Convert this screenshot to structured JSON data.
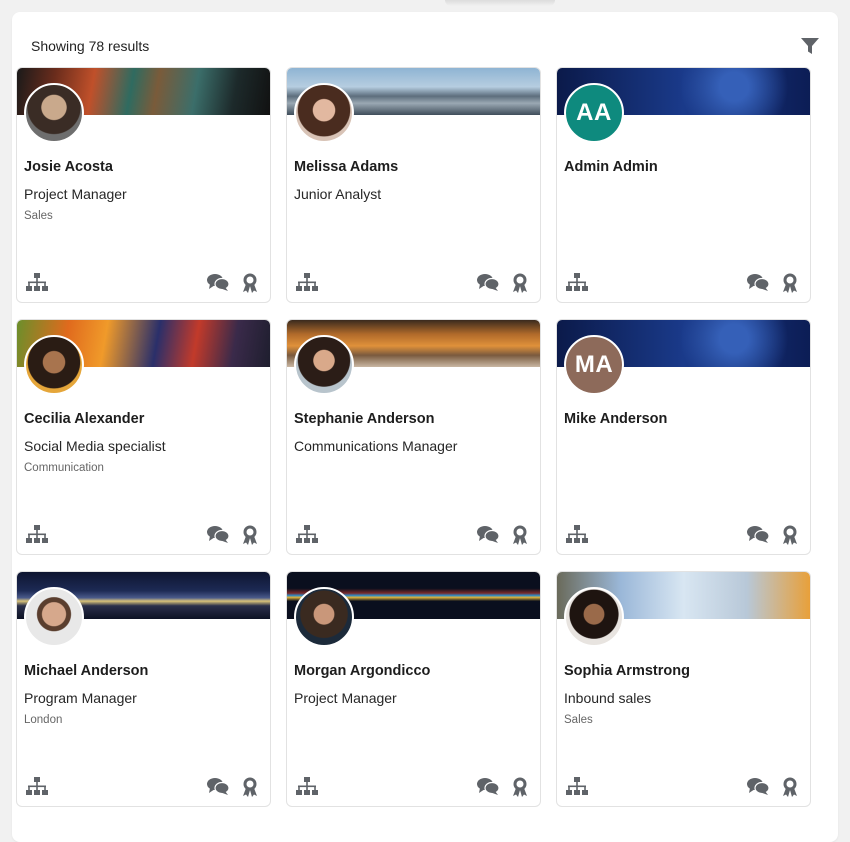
{
  "header": {
    "results_text": "Showing 78 results"
  },
  "icons": {
    "filter": "filter-icon",
    "org": "org-chart-icon",
    "chat": "chat-icon",
    "badge": "badge-icon"
  },
  "colors": {
    "icon_gray": "#5f6368",
    "admin_avatar": "#0e8a7e",
    "mike_avatar": "#8d6a5a"
  },
  "people": [
    {
      "name": "Josie Acosta",
      "title": "Project Manager",
      "department": "Sales"
    },
    {
      "name": "Melissa Adams",
      "title": "Junior Analyst",
      "department": ""
    },
    {
      "name": "Admin Admin",
      "title": "",
      "department": "",
      "initials": "AA"
    },
    {
      "name": "Cecilia Alexander",
      "title": "Social Media specialist",
      "department": "Communication"
    },
    {
      "name": "Stephanie Anderson",
      "title": "Communications Manager",
      "department": ""
    },
    {
      "name": "Mike Anderson",
      "title": "",
      "department": "",
      "initials": "MA"
    },
    {
      "name": "Michael Anderson",
      "title": "Program Manager",
      "department": "London"
    },
    {
      "name": "Morgan Argondicco",
      "title": "Project Manager",
      "department": ""
    },
    {
      "name": "Sophia Armstrong",
      "title": "Inbound sales",
      "department": "Sales"
    }
  ]
}
